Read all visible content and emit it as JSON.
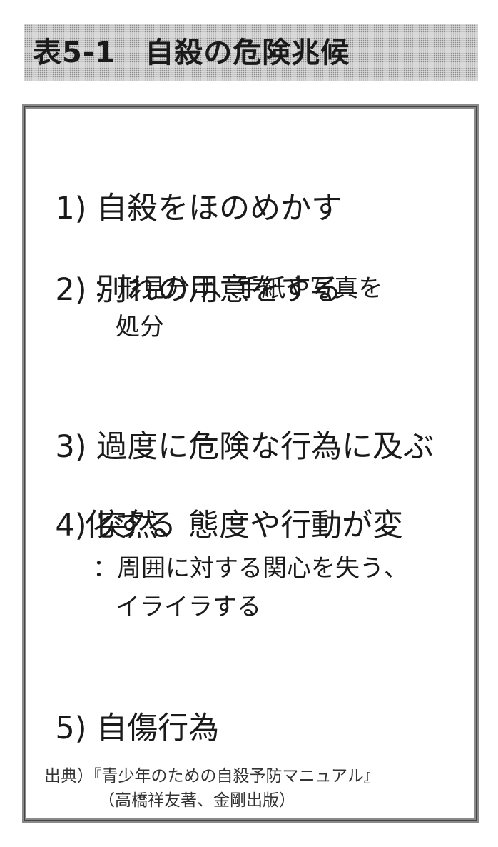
{
  "title": "表5-1　自殺の危険兆候",
  "items": [
    {
      "number": "1)",
      "text": "自殺をほのめかす"
    },
    {
      "number": "2)",
      "text": "別れの用意をする",
      "note_line1": "：形見分け、手紙や写真を",
      "note_line2": "処分"
    },
    {
      "number": "3)",
      "text": "過度に危険な行為に及ぶ"
    },
    {
      "number": "4)",
      "text": "突然、態度や行動が変",
      "text_line2": "化する",
      "note_line1": "：周囲に対する関心を失う、",
      "note_line2": "イライラする"
    },
    {
      "number": "5)",
      "text": "自傷行為"
    }
  ],
  "source": {
    "line1": "出典）『青少年のための自殺予防マニュアル』",
    "line2": "（高橋祥友著、金剛出版）"
  }
}
